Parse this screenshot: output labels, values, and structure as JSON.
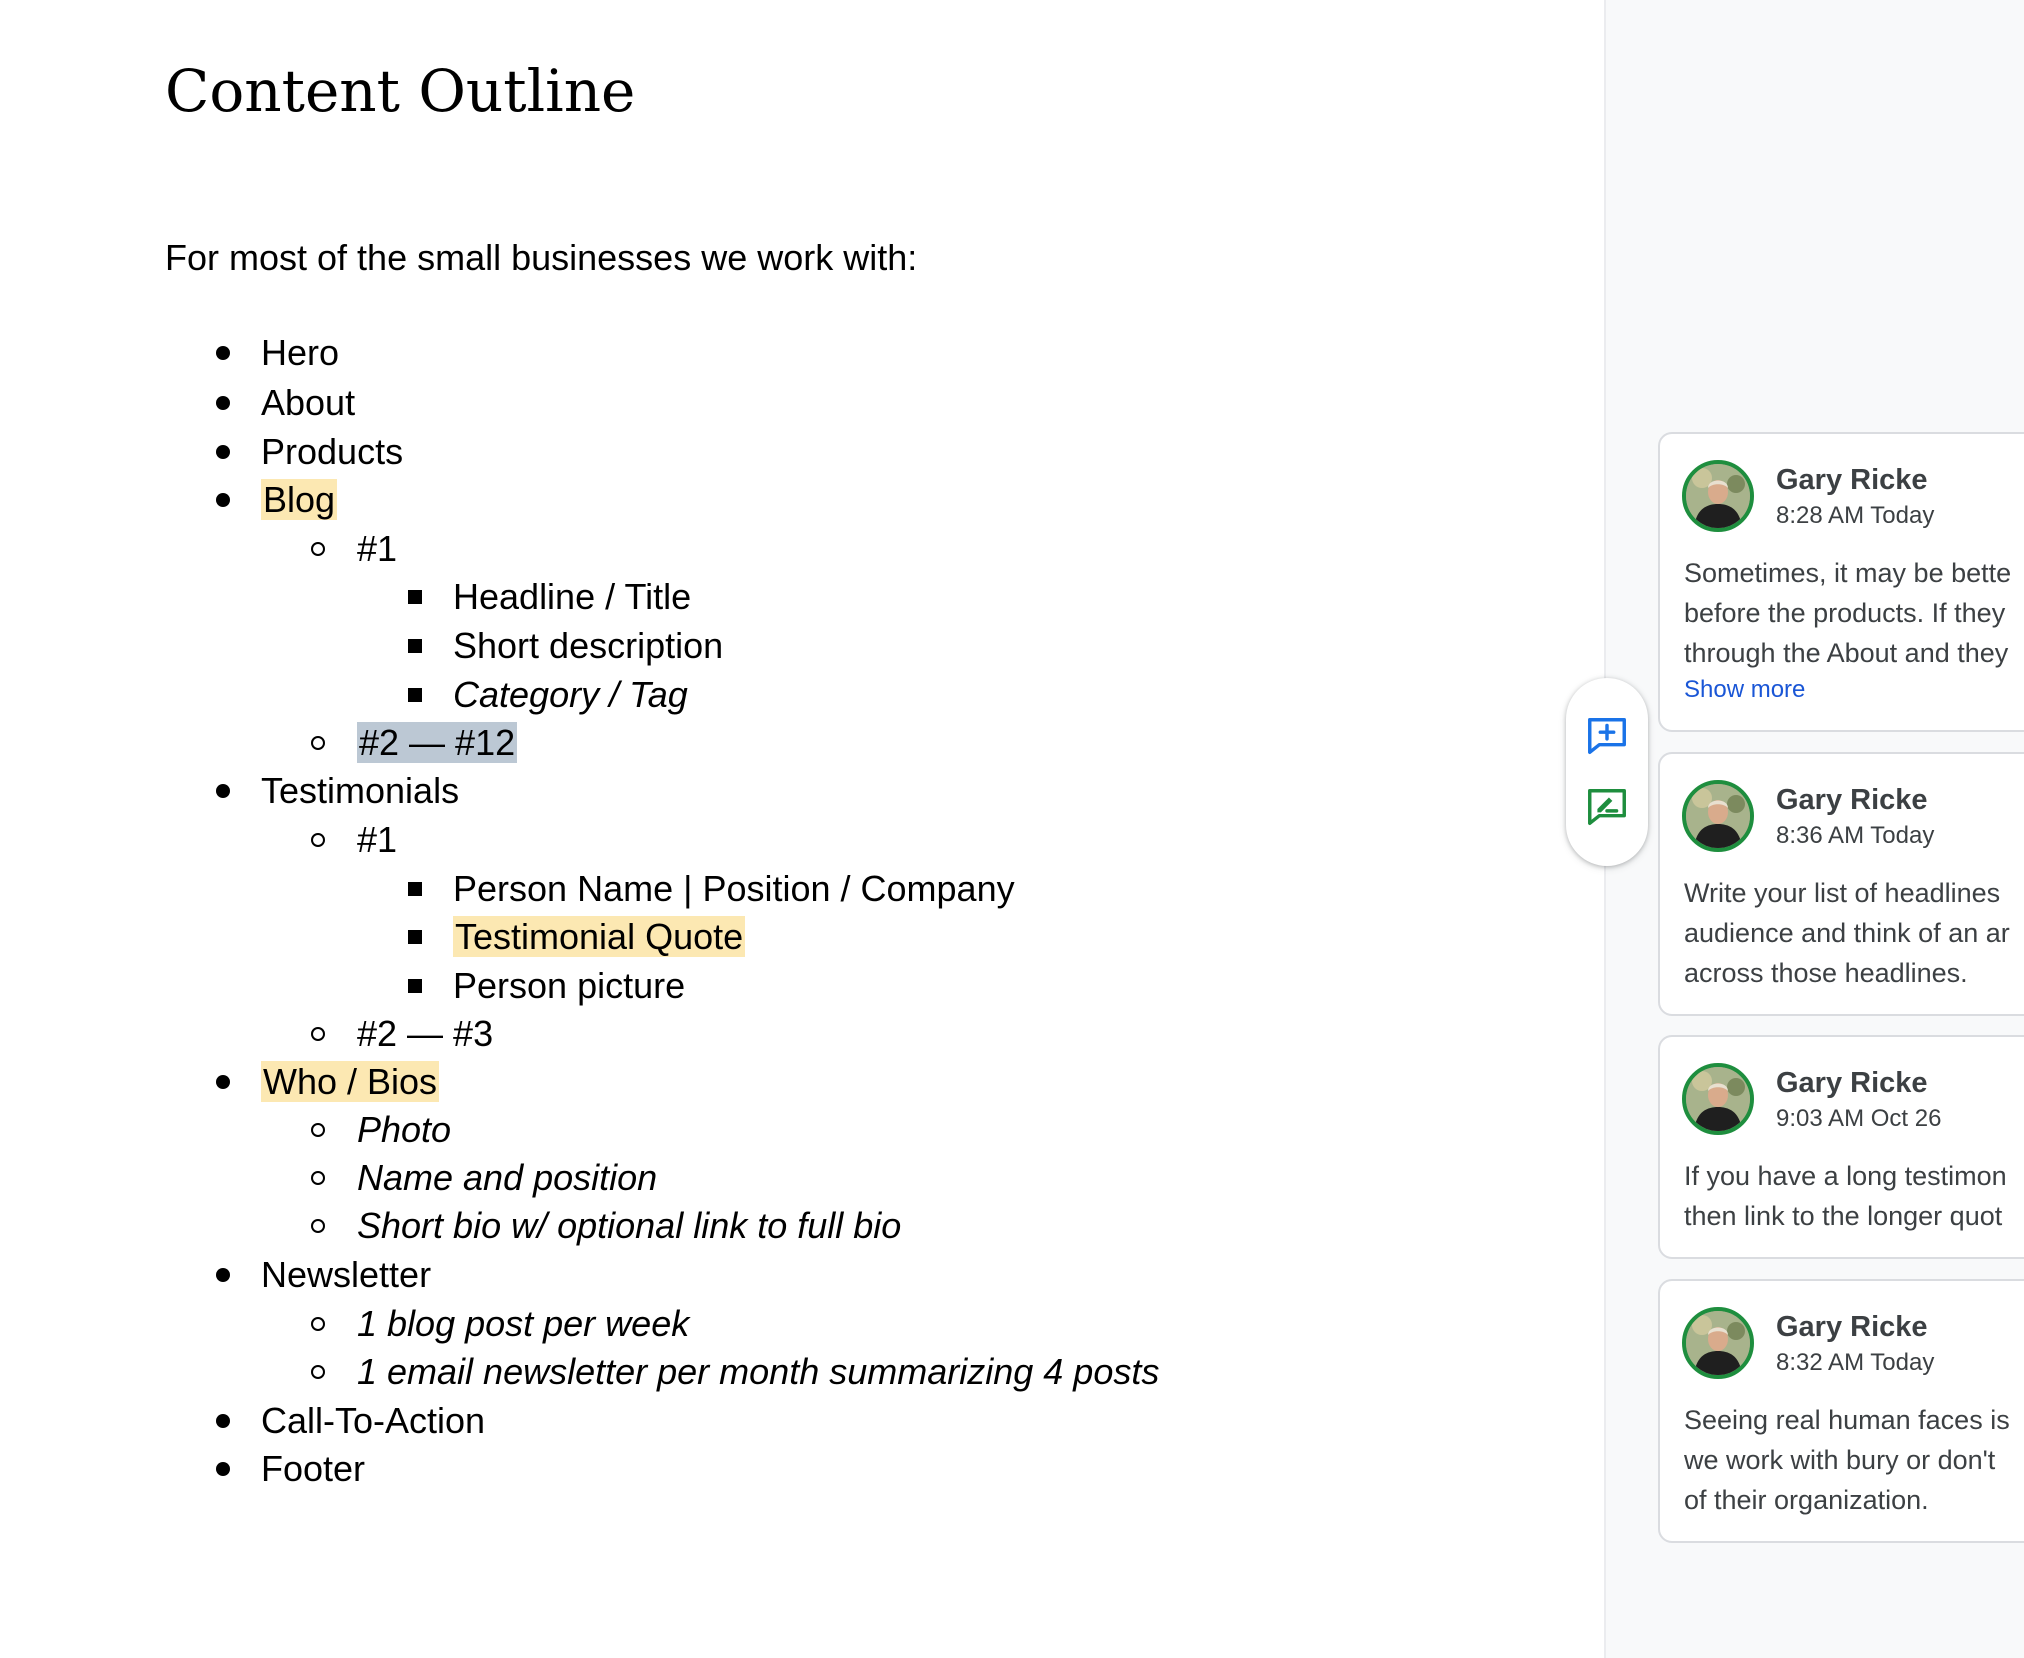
{
  "document": {
    "title": "Content Outline",
    "intro": "For most of the small businesses we work with:",
    "outline": [
      {
        "level": 1,
        "text": "Hero"
      },
      {
        "level": 1,
        "text": "About"
      },
      {
        "level": 1,
        "text": "Products"
      },
      {
        "level": 1,
        "text": "Blog",
        "highlight": "yellow"
      },
      {
        "level": 2,
        "text": "#1"
      },
      {
        "level": 3,
        "text": "Headline / Title"
      },
      {
        "level": 3,
        "text": "Short description"
      },
      {
        "level": 3,
        "text": "Category / Tag",
        "italic": true
      },
      {
        "level": 2,
        "text": "#2 — #12",
        "highlight": "grey"
      },
      {
        "level": 1,
        "text": "Testimonials"
      },
      {
        "level": 2,
        "text": "#1"
      },
      {
        "level": 3,
        "text": "Person Name | Position / Company"
      },
      {
        "level": 3,
        "text": "Testimonial Quote",
        "highlight": "yellow"
      },
      {
        "level": 3,
        "text": "Person picture"
      },
      {
        "level": 2,
        "text": "#2 — #3"
      },
      {
        "level": 1,
        "text": "Who / Bios",
        "highlight": "yellow"
      },
      {
        "level": 2,
        "text": "Photo",
        "italic": true
      },
      {
        "level": 2,
        "text": "Name and position",
        "italic": true
      },
      {
        "level": 2,
        "text": "Short bio w/ optional link to full bio",
        "italic": true
      },
      {
        "level": 1,
        "text": "Newsletter"
      },
      {
        "level": 2,
        "text": "1 blog post per week",
        "italic": true
      },
      {
        "level": 2,
        "text": "1 email newsletter per month summarizing 4 posts",
        "italic": true
      },
      {
        "level": 1,
        "text": "Call-To-Action"
      },
      {
        "level": 1,
        "text": "Footer"
      }
    ]
  },
  "comment_actions": {
    "add_comment_icon": "add-comment-icon",
    "suggest_edit_icon": "suggest-edit-icon"
  },
  "comments": [
    {
      "author": "Gary Ricke",
      "time": "8:28 AM Today",
      "lines": [
        "Sometimes, it may be bette",
        "before the products. If they",
        "through the About and they"
      ],
      "show_more": "Show more"
    },
    {
      "author": "Gary Ricke",
      "time": "8:36 AM Today",
      "lines": [
        "Write your list of headlines",
        "audience and think of an ar",
        "across those headlines."
      ]
    },
    {
      "author": "Gary Ricke",
      "time": "9:03 AM Oct 26",
      "lines": [
        "If you have a long testimon",
        "then link to the longer quot"
      ]
    },
    {
      "author": "Gary Ricke",
      "time": "8:32 AM Today",
      "lines": [
        "Seeing real human faces is",
        "we work with bury or don't",
        "of their organization."
      ]
    }
  ],
  "colors": {
    "highlight_yellow": "#fce8b2",
    "highlight_grey": "#bcc8d4",
    "add_comment_blue": "#1a73e8",
    "suggest_green": "#1e8e3e",
    "link_blue": "#1a56d6"
  }
}
